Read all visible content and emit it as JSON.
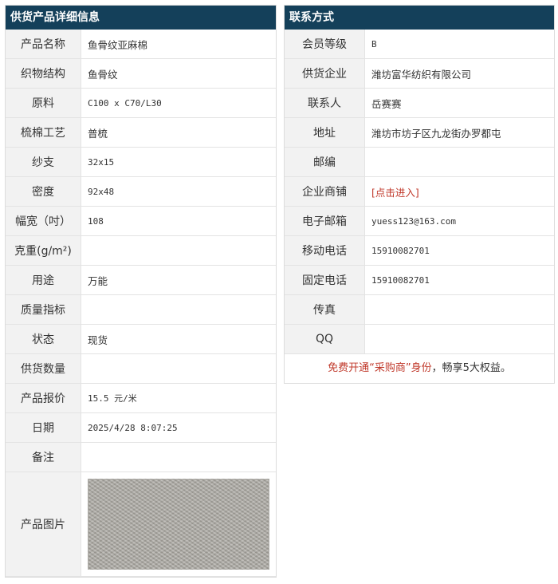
{
  "left_panel": {
    "title": "供货产品详细信息",
    "rows": [
      {
        "label": "产品名称",
        "value": "鱼骨纹亚麻棉"
      },
      {
        "label": "织物结构",
        "value": "鱼骨纹"
      },
      {
        "label": "原料",
        "value": "C100 x C70/L30"
      },
      {
        "label": "梳棉工艺",
        "value": "普梳"
      },
      {
        "label": "纱支",
        "value": "32x15"
      },
      {
        "label": "密度",
        "value": "92x48"
      },
      {
        "label": "幅宽（吋）",
        "value": "108"
      },
      {
        "label": "克重(g/m²)",
        "value": ""
      },
      {
        "label": "用途",
        "value": "万能"
      },
      {
        "label": "质量指标",
        "value": ""
      },
      {
        "label": "状态",
        "value": "现货"
      },
      {
        "label": "供货数量",
        "value": ""
      },
      {
        "label": "产品报价",
        "value": "15.5 元/米"
      },
      {
        "label": "日期",
        "value": "2025/4/28 8:07:25"
      },
      {
        "label": "备注",
        "value": ""
      }
    ],
    "image_label": "产品图片"
  },
  "right_panel": {
    "title": "联系方式",
    "rows": [
      {
        "label": "会员等级",
        "value": "B"
      },
      {
        "label": "供货企业",
        "value": "潍坊富华纺织有限公司"
      },
      {
        "label": "联系人",
        "value": "岳赛赛"
      },
      {
        "label": "地址",
        "value": "潍坊市坊子区九龙街办罗都屯"
      },
      {
        "label": "邮编",
        "value": ""
      },
      {
        "label": "企业商铺",
        "value": "[点击进入]"
      },
      {
        "label": "电子邮箱",
        "value": "yuess123@163.com"
      },
      {
        "label": "移动电话",
        "value": "15910082701"
      },
      {
        "label": "固定电话",
        "value": "15910082701"
      },
      {
        "label": "传真",
        "value": ""
      },
      {
        "label": "QQ",
        "value": ""
      }
    ],
    "promo": {
      "part1": "免费开通",
      "part2": "“采购商”身份",
      "part3": "，畅享5大权益。"
    }
  },
  "colors": {
    "header_bg": "#14405a",
    "label_bg": "#f2f2f2",
    "link_red": "#c0392b"
  }
}
